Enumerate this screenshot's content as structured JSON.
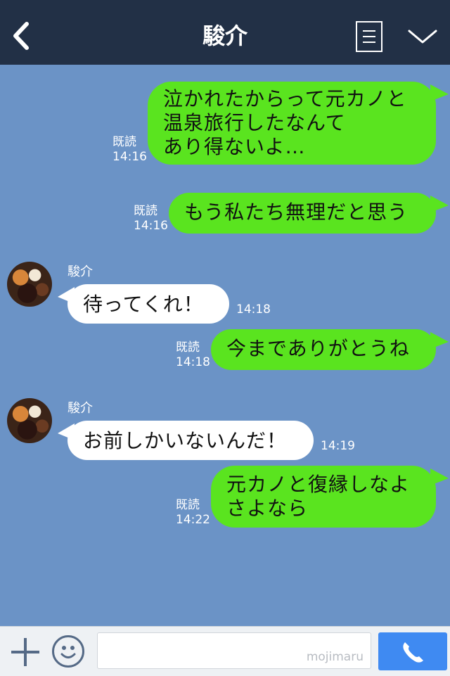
{
  "header": {
    "title": "駿介"
  },
  "messages": [
    {
      "text": "泣かれたからって元カノと\n温泉旅行したなんて\nあり得ないよ…",
      "read": "既読",
      "time": "14:16"
    },
    {
      "text": "もう私たち無理だと思う",
      "read": "既読",
      "time": "14:16"
    },
    {
      "sender": "駿介",
      "text": "待ってくれ！",
      "time": "14:18"
    },
    {
      "text": "今までありがとうね",
      "read": "既読",
      "time": "14:18"
    },
    {
      "sender": "駿介",
      "text": "お前しかいないんだ！",
      "time": "14:19"
    },
    {
      "text": "元カノと復縁しなよ\nさよなら",
      "read": "既読",
      "time": "14:22"
    }
  ],
  "footer": {
    "watermark": "mojimaru"
  },
  "colors": {
    "header": "#223046",
    "chat_bg": "#6b93c6",
    "my_bubble": "#5ae41f",
    "their_bubble": "#ffffff",
    "call_button": "#3f8af2"
  },
  "icons": [
    "back-arrow-icon",
    "menu-list-icon",
    "chevron-down-icon",
    "plus-icon",
    "emoji-icon",
    "phone-icon"
  ]
}
